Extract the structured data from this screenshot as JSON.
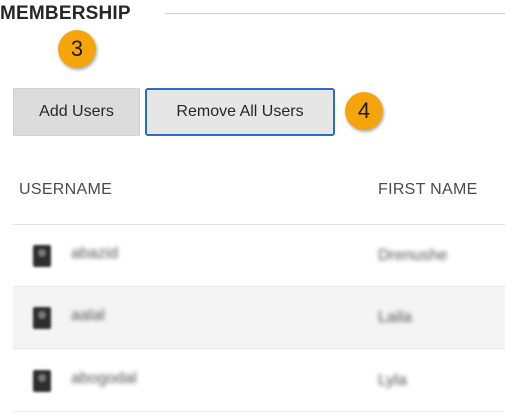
{
  "section": {
    "title": "MEMBERSHIP"
  },
  "callouts": {
    "step_add": "3",
    "step_remove": "4"
  },
  "buttons": {
    "add_users": "Add Users",
    "remove_all_users": "Remove All Users"
  },
  "table": {
    "columns": [
      "USERNAME",
      "FIRST NAME"
    ],
    "rows": [
      {
        "username": "abazid",
        "first_name": "Drenushe"
      },
      {
        "username": "aalal",
        "first_name": "Laila"
      },
      {
        "username": "abogodal",
        "first_name": "Lyla"
      }
    ]
  },
  "colors": {
    "callout": "#f5a40c",
    "focus_border": "#2b6cc4",
    "button_bg": "#dcdcdc",
    "row_alt_bg": "#f4f4f4"
  }
}
